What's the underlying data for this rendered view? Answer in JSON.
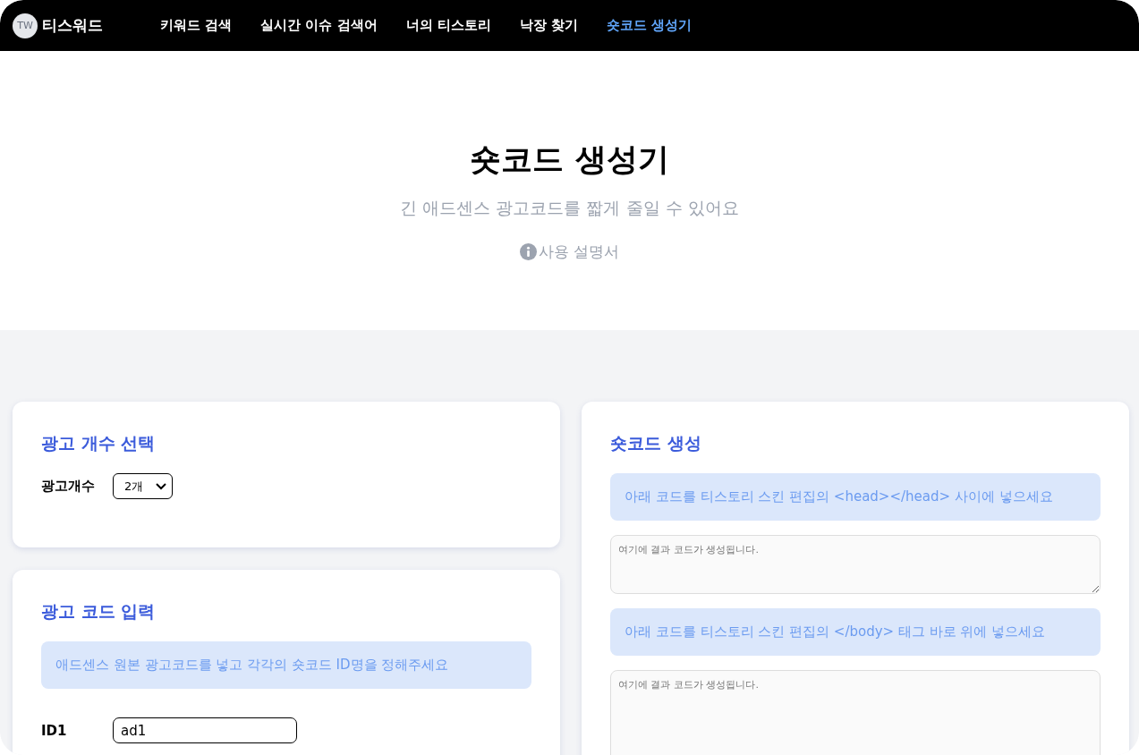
{
  "nav": {
    "logo": {
      "badge": "TW",
      "text": "티스워드"
    },
    "items": [
      {
        "label": "키워드 검색",
        "selected": false
      },
      {
        "label": "실시간 이슈 검색어",
        "selected": false
      },
      {
        "label": "너의 티스토리",
        "selected": false
      },
      {
        "label": "낙장 찾기",
        "selected": false
      },
      {
        "label": "숏코드 생성기",
        "selected": true
      }
    ]
  },
  "hero": {
    "title": "숏코드 생성기",
    "subtitle": "긴 애드센스 광고코드를 짧게 줄일 수 있어요",
    "manual_link": "사용 설명서"
  },
  "count_card": {
    "title": "광고 개수 선택",
    "label": "광고개수",
    "select_value": "2개"
  },
  "input_card": {
    "title": "광고 코드 입력",
    "notice": "애드센스 원본 광고코드를 넣고 각각의 숏코드 ID명을 정해주세요",
    "ids": [
      {
        "label": "ID1",
        "value": "ad1"
      }
    ]
  },
  "output_card": {
    "title": "숏코드 생성",
    "blocks": [
      {
        "notice": "아래 코드를 티스토리 스킨 편집의 <head></head> 사이에 넣으세요",
        "placeholder": "여기에 결과 코드가 생성됩니다."
      },
      {
        "notice": "아래 코드를 티스토리 스킨 편집의 </body> 태그 바로 위에 넣으세요",
        "placeholder": "여기에 결과 코드가 생성됩니다."
      }
    ]
  }
}
